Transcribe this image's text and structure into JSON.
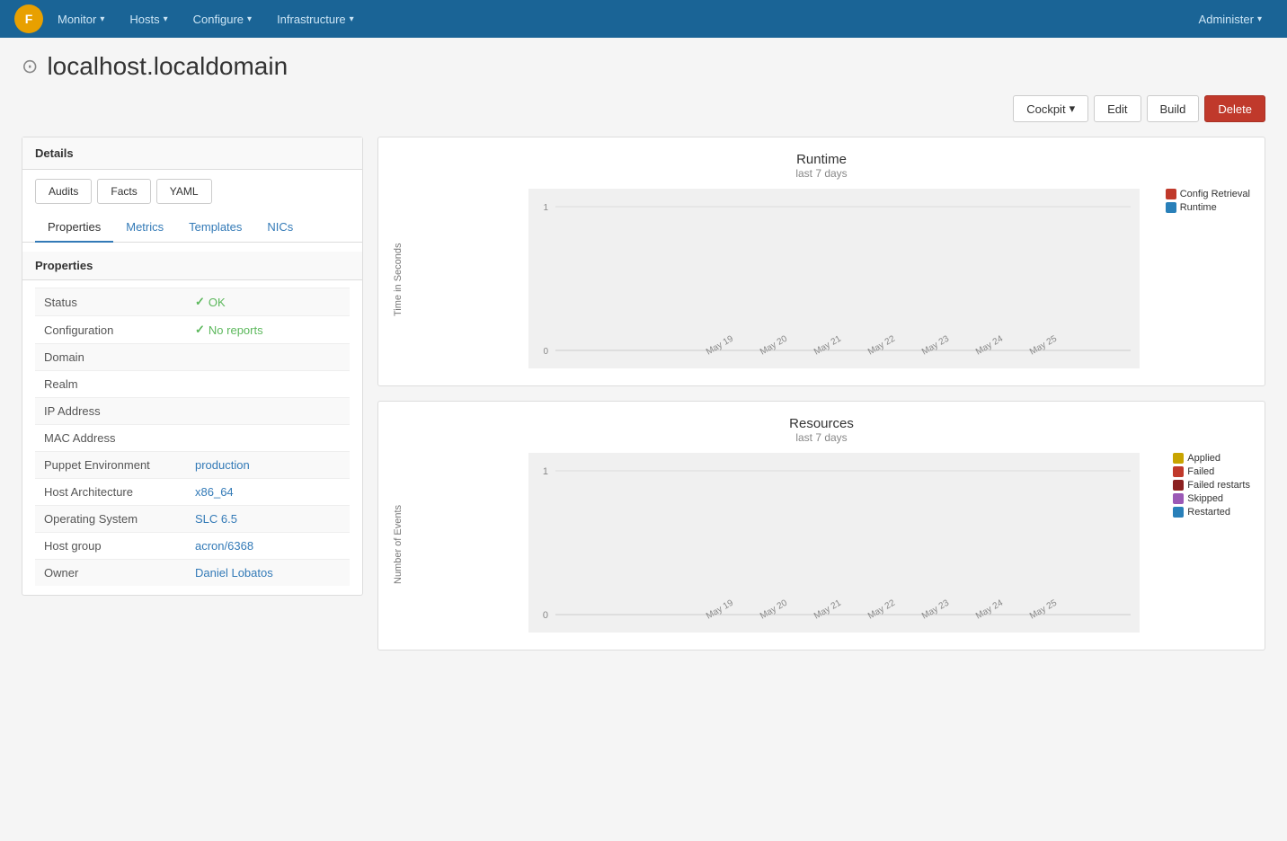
{
  "nav": {
    "logo_text": "F",
    "items": [
      {
        "label": "Monitor",
        "has_dropdown": true
      },
      {
        "label": "Hosts",
        "has_dropdown": true
      },
      {
        "label": "Configure",
        "has_dropdown": true
      },
      {
        "label": "Infrastructure",
        "has_dropdown": true
      }
    ],
    "right_items": [
      {
        "label": "Administer",
        "has_dropdown": true
      }
    ]
  },
  "page": {
    "title": "localhost.localdomain",
    "icon": "🖥"
  },
  "actions": {
    "cockpit_label": "Cockpit",
    "edit_label": "Edit",
    "build_label": "Build",
    "delete_label": "Delete"
  },
  "details": {
    "panel_header": "Details",
    "buttons": [
      "Audits",
      "Facts",
      "YAML"
    ],
    "tabs": [
      "Properties",
      "Metrics",
      "Templates",
      "NICs"
    ],
    "active_tab": "Properties"
  },
  "properties": {
    "header": "Properties",
    "rows": [
      {
        "label": "Status",
        "value": "OK",
        "type": "status_ok"
      },
      {
        "label": "Configuration",
        "value": "No reports",
        "type": "status_ok"
      },
      {
        "label": "Domain",
        "value": "",
        "type": "plain"
      },
      {
        "label": "Realm",
        "value": "",
        "type": "plain"
      },
      {
        "label": "IP Address",
        "value": "",
        "type": "plain"
      },
      {
        "label": "MAC Address",
        "value": "",
        "type": "plain"
      },
      {
        "label": "Puppet Environment",
        "value": "production",
        "type": "link"
      },
      {
        "label": "Host Architecture",
        "value": "x86_64",
        "type": "link"
      },
      {
        "label": "Operating System",
        "value": "SLC 6.5",
        "type": "link"
      },
      {
        "label": "Host group",
        "value": "acron/6368",
        "type": "link"
      },
      {
        "label": "Owner",
        "value": "Daniel Lobatos",
        "type": "link"
      }
    ]
  },
  "runtime_chart": {
    "title": "Runtime",
    "subtitle": "last 7 days",
    "y_label": "Time in Seconds",
    "y_ticks": [
      "1",
      "0"
    ],
    "legend": [
      {
        "label": "Config Retrieval",
        "color": "#c0392b"
      },
      {
        "label": "Runtime",
        "color": "#2980b9"
      }
    ],
    "x_labels": [
      "May 19",
      "May 20",
      "May 21",
      "May 22",
      "May 23",
      "May 24",
      "May 25"
    ]
  },
  "resources_chart": {
    "title": "Resources",
    "subtitle": "last 7 days",
    "y_label": "Number of Events",
    "y_ticks": [
      "1",
      "0"
    ],
    "legend": [
      {
        "label": "Applied",
        "color": "#c8a400"
      },
      {
        "label": "Failed",
        "color": "#c0392b"
      },
      {
        "label": "Failed restarts",
        "color": "#8b2020"
      },
      {
        "label": "Skipped",
        "color": "#9b59b6"
      },
      {
        "label": "Restarted",
        "color": "#2980b9"
      }
    ],
    "x_labels": [
      "May 19",
      "May 20",
      "May 21",
      "May 22",
      "May 23",
      "May 24",
      "May 25"
    ]
  }
}
